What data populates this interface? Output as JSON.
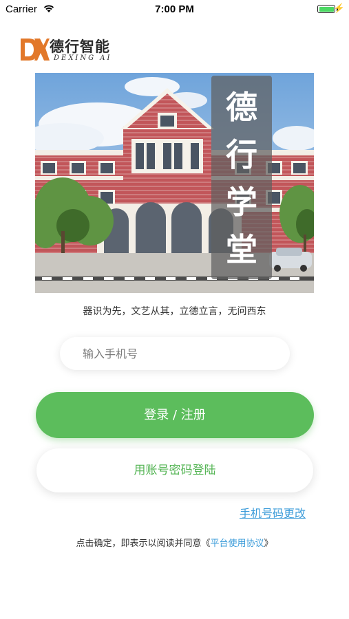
{
  "status_bar": {
    "carrier": "Carrier",
    "time": "7:00 PM",
    "battery_percent": 100,
    "battery_color": "#4cd964"
  },
  "logo": {
    "mark": "DX",
    "title": "德行智能",
    "subtitle": "DEXING AI",
    "mark_color": "#e2782a"
  },
  "banner": {
    "title": "德行学堂"
  },
  "motto": "器识为先，文艺从其，立德立言，无问西东",
  "phone_input": {
    "placeholder": "输入手机号",
    "value": ""
  },
  "login_button": {
    "label": "登录 / 注册",
    "color": "#5cbd5c"
  },
  "password_login_button": {
    "label": "用账号密码登陆"
  },
  "change_phone_link": "手机号码更改",
  "agreement": {
    "prefix": "点击确定，即表示以阅读并同意",
    "open_quote": "《",
    "link": "平台使用协议",
    "close_quote": "》"
  },
  "icons": {
    "wifi": "wifi-icon",
    "battery": "battery-icon",
    "charging": "charging-icon"
  }
}
